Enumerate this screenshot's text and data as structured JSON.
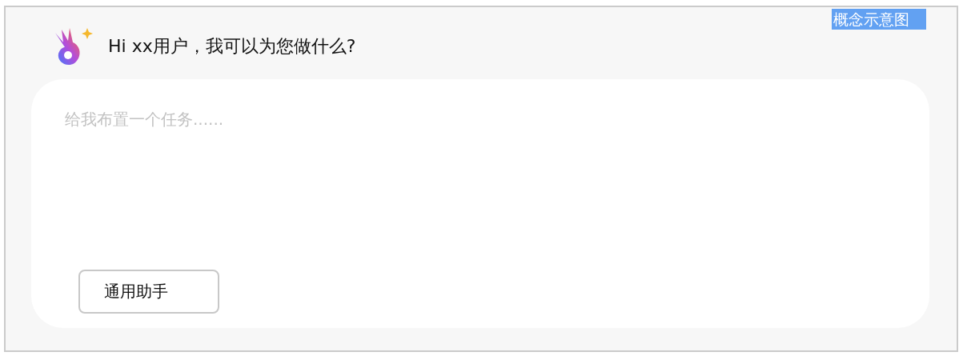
{
  "badge": "概念示意图",
  "greeting": "Hi xx用户，我可以为您做什么?",
  "task_input": {
    "placeholder": "给我布置一个任务......"
  },
  "assistant_button": "通用助手"
}
